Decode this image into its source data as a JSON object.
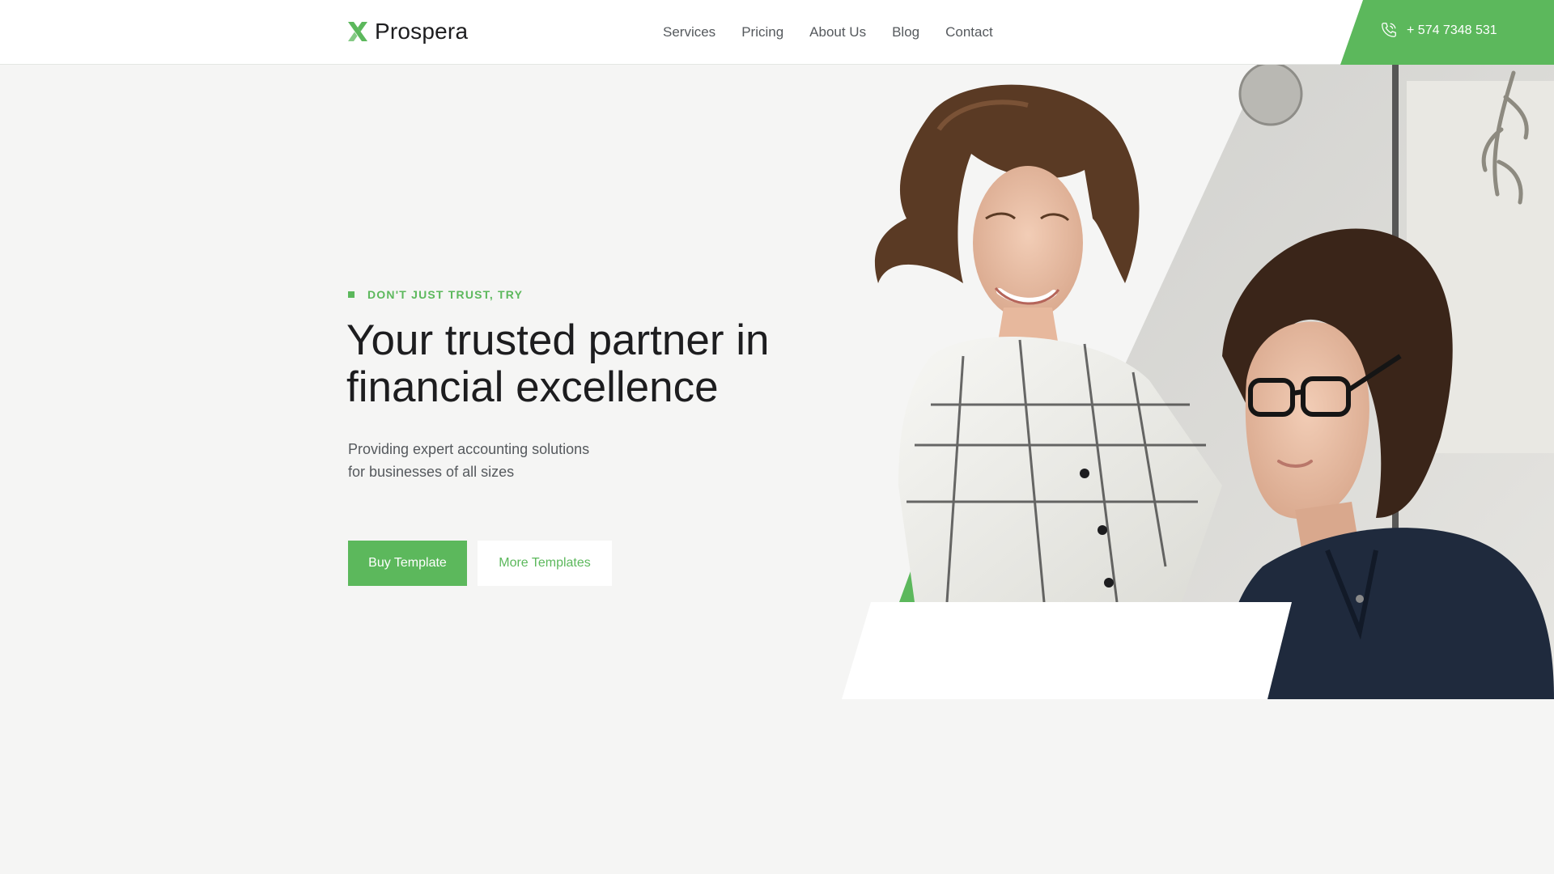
{
  "brand": {
    "name": "Prospera",
    "accent": "#5cb85c",
    "logo_icon": "x-mark-icon"
  },
  "nav": {
    "items": [
      {
        "label": "Services"
      },
      {
        "label": "Pricing"
      },
      {
        "label": "About Us"
      },
      {
        "label": "Blog"
      },
      {
        "label": "Contact"
      }
    ]
  },
  "contact": {
    "phone": "+ 574 7348 531",
    "icon": "phone-icon"
  },
  "hero": {
    "eyebrow": "DON'T JUST TRUST, TRY",
    "title_line1": "Your trusted partner in",
    "title_line2": "financial excellence",
    "subtitle_line1": "Providing expert accounting solutions",
    "subtitle_line2": "for businesses of all sizes",
    "primary_button": "Buy Template",
    "secondary_button": "More Templates",
    "image_alt": "two-women-office-photo"
  },
  "colors": {
    "page_background": "#f5f5f4",
    "header_background": "#ffffff",
    "heading_text": "#1d1d1f",
    "body_text": "#55595d"
  }
}
